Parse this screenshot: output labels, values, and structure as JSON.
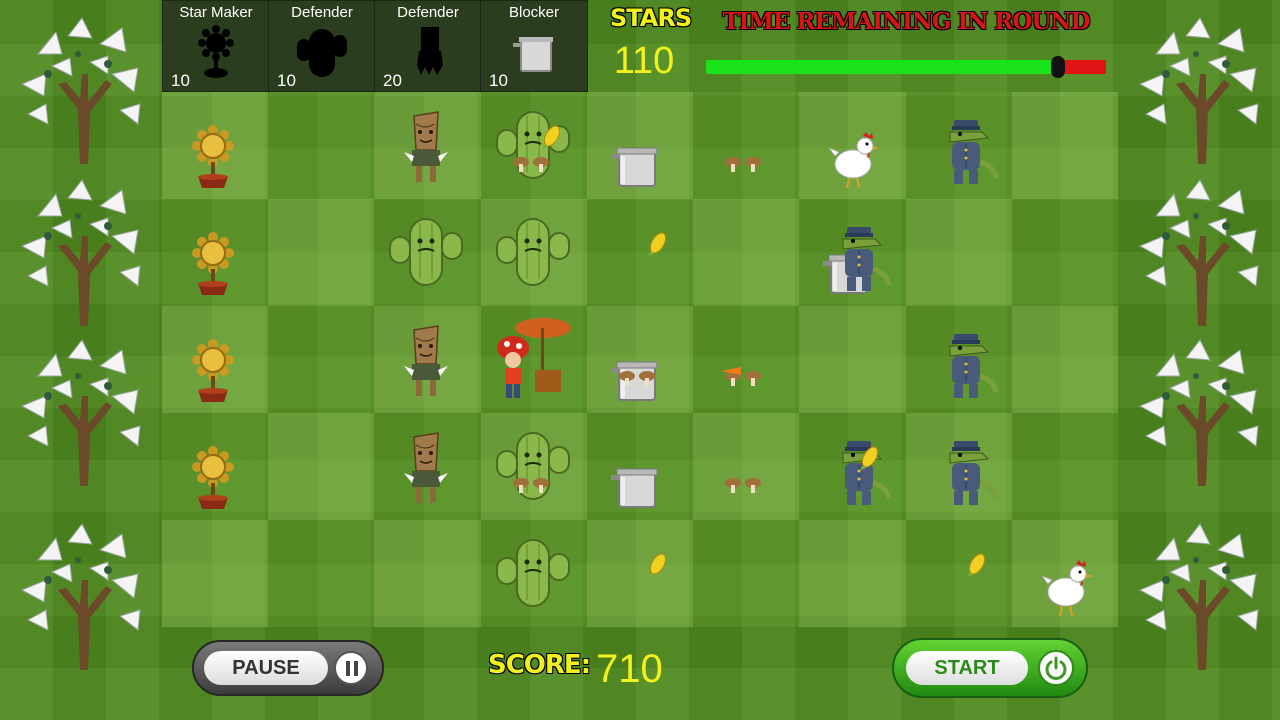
{
  "seed_packets": [
    {
      "name": "Star Maker",
      "cost": "10",
      "icon": "sunflower-silhouette-icon"
    },
    {
      "name": "Defender",
      "cost": "10",
      "icon": "cactus-silhouette-icon"
    },
    {
      "name": "Defender",
      "cost": "20",
      "icon": "tree-root-silhouette-icon"
    },
    {
      "name": "Blocker",
      "cost": "10",
      "icon": "pot-icon"
    }
  ],
  "stars": {
    "label": "STARS",
    "value": "110"
  },
  "timer": {
    "label": "TIME REMAINING IN ROUND",
    "fraction_remaining": 0.88
  },
  "score": {
    "label": "SCORE:",
    "value": "710"
  },
  "buttons": {
    "pause": "PAUSE",
    "start": "START"
  },
  "colors": {
    "grass": "#4f8a1e",
    "stars_text": "#f2f21a",
    "timer_label": "#d91414",
    "timer_bar_remaining": "#1ae21a",
    "timer_bar_elapsed": "#e01414",
    "start_button": "#3cb024",
    "pause_button": "#555555"
  },
  "board": {
    "rows": 5,
    "cols": 9,
    "units": [
      {
        "type": "star-maker",
        "row": 0,
        "col": 0
      },
      {
        "type": "star-maker",
        "row": 1,
        "col": 0
      },
      {
        "type": "star-maker",
        "row": 2,
        "col": 0
      },
      {
        "type": "star-maker",
        "row": 3,
        "col": 0
      },
      {
        "type": "tree-defender",
        "row": 0,
        "col": 2
      },
      {
        "type": "tree-defender",
        "row": 2,
        "col": 2
      },
      {
        "type": "tree-defender",
        "row": 3,
        "col": 2
      },
      {
        "type": "cactus-defender",
        "row": 0,
        "col": 3
      },
      {
        "type": "cactus-defender",
        "row": 1,
        "col": 2
      },
      {
        "type": "cactus-defender",
        "row": 1,
        "col": 3
      },
      {
        "type": "cactus-defender",
        "row": 3,
        "col": 3
      },
      {
        "type": "cactus-defender",
        "row": 4,
        "col": 3
      },
      {
        "type": "mushroom-vendor",
        "row": 2,
        "col": 3
      },
      {
        "type": "pot-blocker",
        "row": 0,
        "col": 4
      },
      {
        "type": "pot-blocker",
        "row": 1,
        "col": 6
      },
      {
        "type": "pot-blocker",
        "row": 2,
        "col": 4
      },
      {
        "type": "pot-blocker",
        "row": 3,
        "col": 4
      },
      {
        "type": "chicken",
        "row": 0,
        "col": 6
      },
      {
        "type": "chicken",
        "row": 4,
        "col": 8
      },
      {
        "type": "crocodile-soldier",
        "row": 0,
        "col": 7
      },
      {
        "type": "crocodile-soldier",
        "row": 1,
        "col": 6
      },
      {
        "type": "crocodile-soldier",
        "row": 2,
        "col": 7
      },
      {
        "type": "crocodile-soldier",
        "row": 3,
        "col": 6
      },
      {
        "type": "crocodile-soldier",
        "row": 3,
        "col": 7
      },
      {
        "type": "mushroom-projectile",
        "row": 0,
        "col": 3
      },
      {
        "type": "mushroom-projectile",
        "row": 0,
        "col": 5
      },
      {
        "type": "mushroom-projectile",
        "row": 2,
        "col": 4
      },
      {
        "type": "mushroom-projectile",
        "row": 2,
        "col": 5
      },
      {
        "type": "mushroom-projectile",
        "row": 3,
        "col": 3
      },
      {
        "type": "mushroom-projectile",
        "row": 3,
        "col": 5
      },
      {
        "type": "corn-projectile",
        "row": 0,
        "col": 3
      },
      {
        "type": "corn-projectile",
        "row": 1,
        "col": 4
      },
      {
        "type": "corn-projectile",
        "row": 3,
        "col": 6
      },
      {
        "type": "corn-projectile",
        "row": 4,
        "col": 4
      },
      {
        "type": "corn-projectile",
        "row": 4,
        "col": 7
      },
      {
        "type": "carrot-projectile",
        "row": 2,
        "col": 5
      }
    ]
  }
}
